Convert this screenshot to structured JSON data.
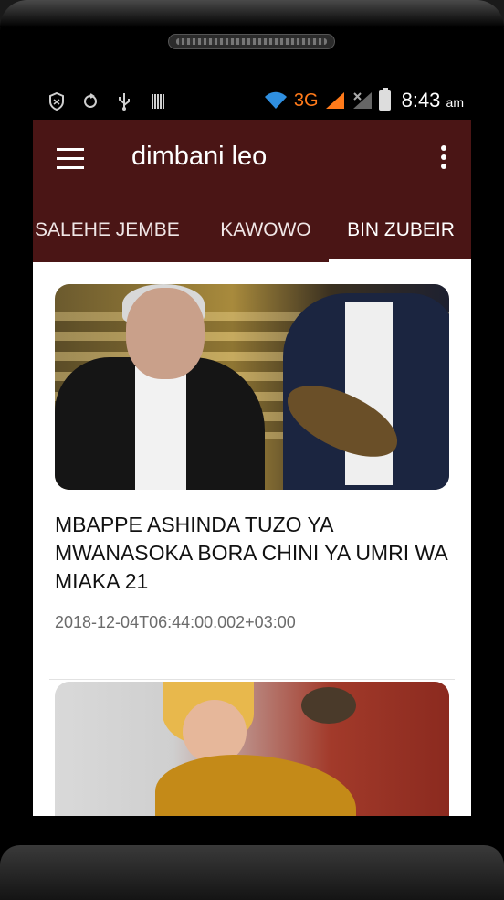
{
  "status_bar": {
    "network_type": "3G",
    "time": "8:43",
    "ampm": "am",
    "icons": [
      "shield-icon",
      "sync-icon",
      "usb-icon",
      "barcode-icon",
      "wifi-icon",
      "signal-icon",
      "signal-icon",
      "battery-charging-icon"
    ]
  },
  "app_bar": {
    "title": "dimbani leo",
    "menu_icon": "hamburger-menu-icon",
    "overflow_icon": "more-vert-icon"
  },
  "tabs": [
    {
      "label": "SALEHE JEMBE",
      "selected": false
    },
    {
      "label": "KAWOWO",
      "selected": false
    },
    {
      "label": "BIN ZUBEIR",
      "selected": true
    }
  ],
  "articles": [
    {
      "title": "MBAPPE ASHINDA TUZO YA MWANASOKA BORA CHINI YA UMRI WA MIAKA 21",
      "date": "2018-12-04T06:44:00.002+03:00"
    },
    {
      "title": "",
      "date": ""
    }
  ],
  "colors": {
    "app_bar": "#4a1515",
    "accent_3g": "#ff7a1a",
    "tab_indicator": "#ffffff"
  }
}
